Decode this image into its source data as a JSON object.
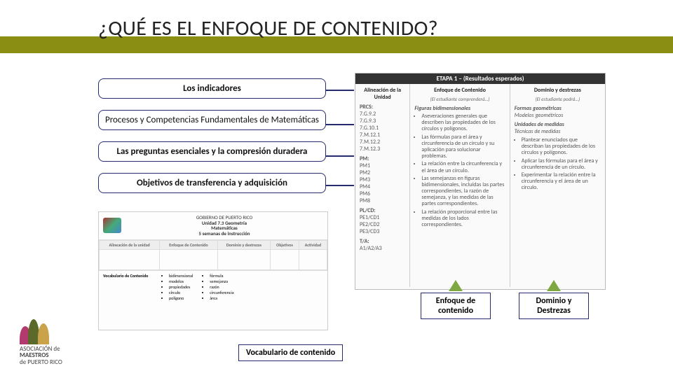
{
  "title": "¿QUÉ ES EL ENFOQUE DE CONTENIDO?",
  "left_boxes": {
    "b1": "Los indicadores",
    "b2": "Procesos y Competencias Fundamentales de Matemáticas",
    "b3": "Las preguntas esenciales y la compresión duradera",
    "b4": "Objetivos de transferencia y adquisición"
  },
  "right_doc": {
    "header": "ETAPA 1 – (Resultados esperados)",
    "col1": {
      "title": "Alineación de la Unidad"
    },
    "col2": {
      "title": "Enfoque de Contenido",
      "sub": "(El estudiante comprenderá…)"
    },
    "col3": {
      "title": "Dominio y destrezas",
      "sub": "(El estudiante podrá…)"
    },
    "codes": {
      "prcs_label": "PRCS:",
      "prcs": "7.G.9.2\n7.G.9.3\n7.G.10.1\n7.M.12.1\n7.M.12.2\n7.M.12.3",
      "pm_label": "PM:",
      "pm": "PM1\nPM2\nPM3\nPM4\nPM6\nPM8",
      "plcd_label": "PL/CD:",
      "plcd": "PE1/CD1\nPE2/CD2\nPE3/CD3",
      "ta_label": "T/A:",
      "ta": "A1/A2/A3"
    },
    "col2_head": "Figuras bidimensionales",
    "col2_items": [
      "Aseveraciones generales que describen las propiedades de los círculos y polígonos.",
      "Las fórmulas para el área y circunferencia de un círculo y su aplicación para solucionar problemas.",
      "La relación entre la circunferencia y el área de un círculo.",
      "Las semejanzas en figuras bidimensionales, incluidas las partes correspondientes, la razón de semejanza, y las medidas de las partes correspondientes.",
      "La relación proporcional entre las medidas de los lados correspondientes."
    ],
    "col3_head1": "Formas geométricas",
    "col3_sub1": "Modelos geométricos",
    "col3_head2": "Unidades de medidas",
    "col3_sub2": "Técnicas de medidas",
    "col3_items": [
      "Plantear enunciados que describan las propiedades de los círculos y polígonos.",
      "Aplicar las fórmulas para el área y circunferencia de un círculo.",
      "Experimentar la relación entre la circunferencia y el área de un círculo."
    ]
  },
  "tags": {
    "enfoque": "Enfoque de contenido",
    "dominio": "Dominio y Destrezas",
    "vocab": "Vocabulario de contenido"
  },
  "bottom_doc": {
    "org": "GOBIERNO DE PUERTO RICO",
    "unit": "Unidad 7.3 Geometría\nMatemáticas\n5 semanas de instrucción",
    "tbl_heads": [
      "Alineación de la unidad",
      "Enfoque de Contenido",
      "Dominio y destrezas",
      "Objetivos",
      "Actividad"
    ],
    "vocab_label": "Vocabulario de Contenido",
    "vocab_col1": [
      "bidimensional",
      "modelos",
      "propiedades",
      "círculo",
      "polígono"
    ],
    "vocab_col2": [
      "fórmula",
      "semejanza",
      "razón",
      "circunferencia",
      "área"
    ]
  },
  "logo": {
    "line1": "ASOCIACIÓN de",
    "line2": "MAESTROS",
    "line3": "de PUERTO RICO"
  }
}
